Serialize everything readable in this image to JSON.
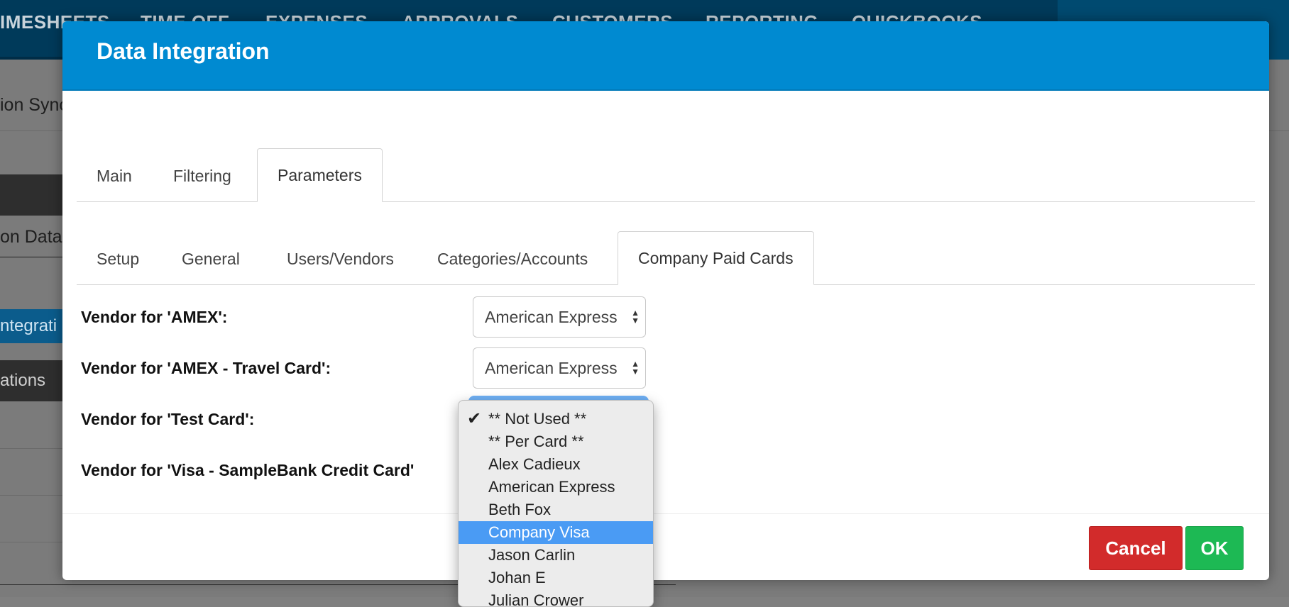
{
  "background": {
    "nav_items": [
      "IMESHEETS",
      "TIME OFF",
      "EXPENSES",
      "APPROVALS",
      "CUSTOMERS",
      "REPORTING",
      "QUICKBOOKS ONLINE"
    ],
    "left_texts": [
      "ion Sync",
      "on Data",
      "ntegrati",
      "ations"
    ]
  },
  "modal": {
    "title": "Data Integration",
    "tabs": [
      {
        "label": "Main"
      },
      {
        "label": "Filtering"
      },
      {
        "label": "Parameters"
      }
    ],
    "subtabs": [
      {
        "label": "Setup"
      },
      {
        "label": "General"
      },
      {
        "label": "Users/Vendors"
      },
      {
        "label": "Categories/Accounts"
      },
      {
        "label": "Company Paid Cards"
      }
    ],
    "fields": [
      {
        "label": "Vendor for 'AMEX':",
        "value": "American Express"
      },
      {
        "label": "Vendor for 'AMEX - Travel Card':",
        "value": "American Express"
      },
      {
        "label": "Vendor for 'Test Card':",
        "value": ""
      },
      {
        "label": "Vendor for 'Visa - SampleBank Credit Card'",
        "value": ""
      }
    ],
    "cancel_label": "Cancel",
    "ok_label": "OK"
  },
  "dropdown": {
    "check_glyph": "✔",
    "items": [
      {
        "label": "** Not Used **"
      },
      {
        "label": "** Per Card **"
      },
      {
        "label": "Alex Cadieux"
      },
      {
        "label": "American Express"
      },
      {
        "label": "Beth Fox"
      },
      {
        "label": "Company Visa"
      },
      {
        "label": "Jason Carlin"
      },
      {
        "label": "Johan E"
      },
      {
        "label": "Julian Crower"
      }
    ]
  }
}
